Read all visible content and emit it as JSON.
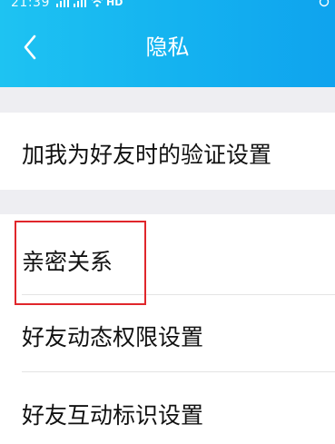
{
  "status_bar": {
    "time": "21:39",
    "network_label": "HD"
  },
  "header": {
    "title": "隐私"
  },
  "settings": {
    "items": [
      {
        "label": "加我为好友时的验证设置"
      },
      {
        "label": "亲密关系"
      },
      {
        "label": "好友动态权限设置"
      },
      {
        "label": "好友互动标识设置"
      }
    ]
  },
  "colors": {
    "header_gradient_start": "#1ec3f2",
    "header_gradient_end": "#0fa3ee",
    "section_gap": "#eeeef2",
    "highlight": "#e0262b"
  }
}
